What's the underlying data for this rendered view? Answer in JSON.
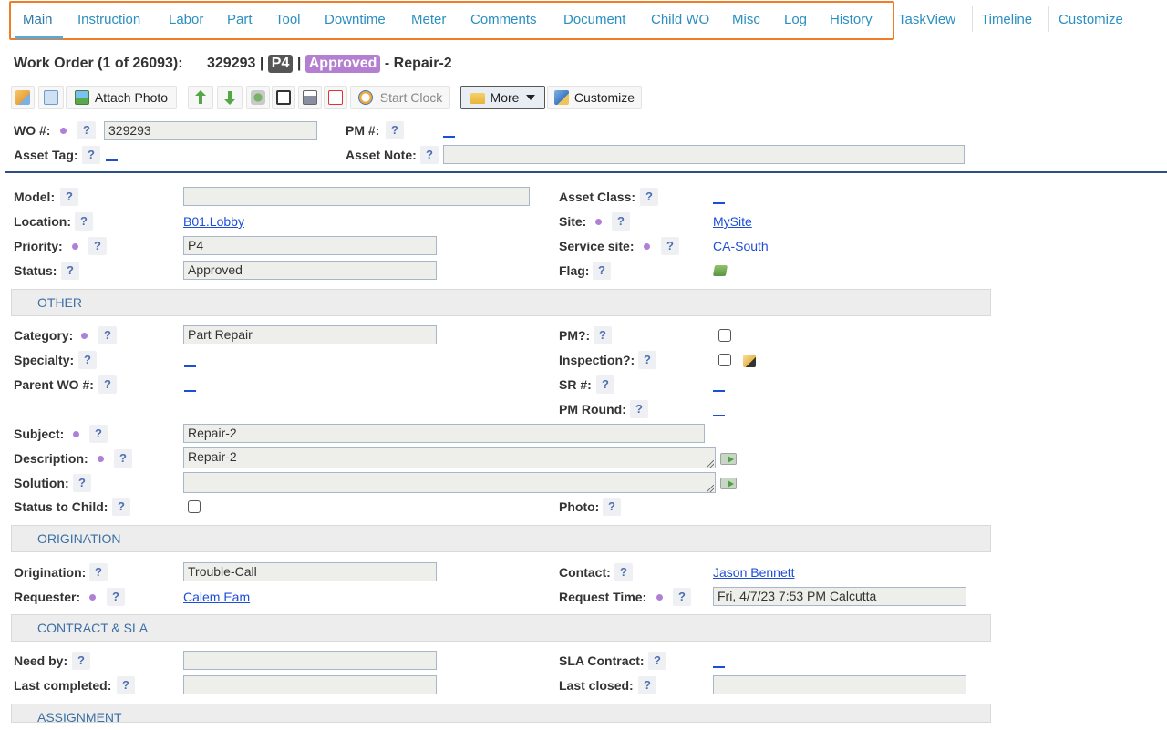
{
  "tabs": [
    {
      "label": "Main"
    },
    {
      "label": "Instruction"
    },
    {
      "label": "Labor"
    },
    {
      "label": "Part"
    },
    {
      "label": "Tool"
    },
    {
      "label": "Downtime"
    },
    {
      "label": "Meter"
    },
    {
      "label": "Comments"
    },
    {
      "label": "Document"
    },
    {
      "label": "Child WO"
    },
    {
      "label": "Misc"
    },
    {
      "label": "Log"
    },
    {
      "label": "History"
    },
    {
      "label": "TaskView"
    },
    {
      "label": "Timeline"
    },
    {
      "label": "Customize"
    }
  ],
  "header": {
    "prefix": "Work Order (1 of 26093):",
    "wo_number": "329293",
    "sep1": "|",
    "priority_badge": "P4",
    "sep2": "|",
    "status_badge": "Approved",
    "suffix": "- Repair-2"
  },
  "toolbar": {
    "attach_photo": "Attach Photo",
    "start_clock": "Start Clock",
    "more": "More",
    "customize": "Customize"
  },
  "top_fields": {
    "wo_label": "WO #:",
    "wo_value": "329293",
    "pm_label": "PM #:",
    "asset_tag_label": "Asset Tag:",
    "asset_note_label": "Asset Note:",
    "asset_note_value": ""
  },
  "help": "?",
  "main": {
    "model_label": "Model:",
    "model_value": "",
    "asset_class_label": "Asset Class:",
    "location_label": "Location:",
    "location_value": "B01.Lobby",
    "site_label": "Site:",
    "site_value": "MySite",
    "priority_label": "Priority:",
    "priority_value": "P4",
    "service_site_label": "Service site:",
    "service_site_value": "CA-South",
    "status_label": "Status:",
    "status_value": "Approved",
    "flag_label": "Flag:"
  },
  "other": {
    "section_title": "OTHER",
    "category_label": "Category:",
    "category_value": "Part Repair",
    "pm_q_label": "PM?:",
    "specialty_label": "Specialty:",
    "inspection_label": "Inspection?:",
    "parent_wo_label": "Parent WO #:",
    "sr_label": "SR #:",
    "pm_round_label": "PM Round:",
    "subject_label": "Subject:",
    "subject_value": "Repair-2",
    "description_label": "Description:",
    "description_value": "Repair-2",
    "solution_label": "Solution:",
    "solution_value": "",
    "status_to_child_label": "Status to Child:",
    "photo_label": "Photo:"
  },
  "origination": {
    "section_title": "ORIGINATION",
    "origination_label": "Origination:",
    "origination_value": "Trouble-Call",
    "contact_label": "Contact:",
    "contact_value": "Jason Bennett",
    "requester_label": "Requester:",
    "requester_value": "Calem Eam",
    "request_time_label": "Request Time:",
    "request_time_value": "Fri, 4/7/23 7:53 PM Calcutta"
  },
  "contract": {
    "section_title": "CONTRACT & SLA",
    "need_by_label": "Need by:",
    "need_by_value": "",
    "sla_contract_label": "SLA Contract:",
    "last_completed_label": "Last completed:",
    "last_completed_value": "",
    "last_closed_label": "Last closed:",
    "last_closed_value": ""
  },
  "assignment": {
    "section_title": "ASSIGNMENT"
  },
  "colors": {
    "tab_text": "#2a8fc2",
    "tab_highlight": "#f07d25",
    "link": "#1d4ed8",
    "required_dot": "#b07fd6",
    "approved_badge": "#b57fd1",
    "section_text": "#3c6fa4"
  }
}
